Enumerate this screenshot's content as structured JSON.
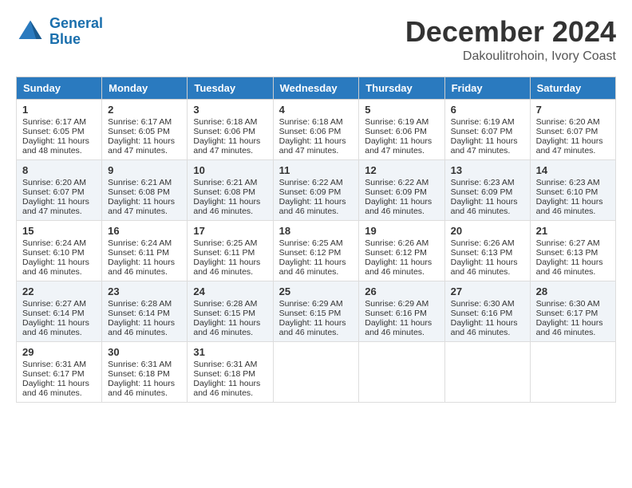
{
  "header": {
    "logo_line1": "General",
    "logo_line2": "Blue",
    "main_title": "December 2024",
    "subtitle": "Dakoulitrohoin, Ivory Coast"
  },
  "calendar": {
    "days_of_week": [
      "Sunday",
      "Monday",
      "Tuesday",
      "Wednesday",
      "Thursday",
      "Friday",
      "Saturday"
    ],
    "weeks": [
      [
        null,
        {
          "day": 2,
          "sunrise": "6:17 AM",
          "sunset": "6:05 PM",
          "daylight": "11 hours and 47 minutes."
        },
        {
          "day": 3,
          "sunrise": "6:18 AM",
          "sunset": "6:06 PM",
          "daylight": "11 hours and 47 minutes."
        },
        {
          "day": 4,
          "sunrise": "6:18 AM",
          "sunset": "6:06 PM",
          "daylight": "11 hours and 47 minutes."
        },
        {
          "day": 5,
          "sunrise": "6:19 AM",
          "sunset": "6:06 PM",
          "daylight": "11 hours and 47 minutes."
        },
        {
          "day": 6,
          "sunrise": "6:19 AM",
          "sunset": "6:07 PM",
          "daylight": "11 hours and 47 minutes."
        },
        {
          "day": 7,
          "sunrise": "6:20 AM",
          "sunset": "6:07 PM",
          "daylight": "11 hours and 47 minutes."
        }
      ],
      [
        {
          "day": 1,
          "sunrise": "6:17 AM",
          "sunset": "6:05 PM",
          "daylight": "11 hours and 48 minutes."
        },
        {
          "day": 8,
          "sunrise": "6:20 AM",
          "sunset": "6:07 PM",
          "daylight": "11 hours and 47 minutes."
        },
        {
          "day": 9,
          "sunrise": "6:21 AM",
          "sunset": "6:08 PM",
          "daylight": "11 hours and 47 minutes."
        },
        {
          "day": 10,
          "sunrise": "6:21 AM",
          "sunset": "6:08 PM",
          "daylight": "11 hours and 46 minutes."
        },
        {
          "day": 11,
          "sunrise": "6:22 AM",
          "sunset": "6:09 PM",
          "daylight": "11 hours and 46 minutes."
        },
        {
          "day": 12,
          "sunrise": "6:22 AM",
          "sunset": "6:09 PM",
          "daylight": "11 hours and 46 minutes."
        },
        {
          "day": 13,
          "sunrise": "6:23 AM",
          "sunset": "6:09 PM",
          "daylight": "11 hours and 46 minutes."
        },
        {
          "day": 14,
          "sunrise": "6:23 AM",
          "sunset": "6:10 PM",
          "daylight": "11 hours and 46 minutes."
        }
      ],
      [
        {
          "day": 15,
          "sunrise": "6:24 AM",
          "sunset": "6:10 PM",
          "daylight": "11 hours and 46 minutes."
        },
        {
          "day": 16,
          "sunrise": "6:24 AM",
          "sunset": "6:11 PM",
          "daylight": "11 hours and 46 minutes."
        },
        {
          "day": 17,
          "sunrise": "6:25 AM",
          "sunset": "6:11 PM",
          "daylight": "11 hours and 46 minutes."
        },
        {
          "day": 18,
          "sunrise": "6:25 AM",
          "sunset": "6:12 PM",
          "daylight": "11 hours and 46 minutes."
        },
        {
          "day": 19,
          "sunrise": "6:26 AM",
          "sunset": "6:12 PM",
          "daylight": "11 hours and 46 minutes."
        },
        {
          "day": 20,
          "sunrise": "6:26 AM",
          "sunset": "6:13 PM",
          "daylight": "11 hours and 46 minutes."
        },
        {
          "day": 21,
          "sunrise": "6:27 AM",
          "sunset": "6:13 PM",
          "daylight": "11 hours and 46 minutes."
        }
      ],
      [
        {
          "day": 22,
          "sunrise": "6:27 AM",
          "sunset": "6:14 PM",
          "daylight": "11 hours and 46 minutes."
        },
        {
          "day": 23,
          "sunrise": "6:28 AM",
          "sunset": "6:14 PM",
          "daylight": "11 hours and 46 minutes."
        },
        {
          "day": 24,
          "sunrise": "6:28 AM",
          "sunset": "6:15 PM",
          "daylight": "11 hours and 46 minutes."
        },
        {
          "day": 25,
          "sunrise": "6:29 AM",
          "sunset": "6:15 PM",
          "daylight": "11 hours and 46 minutes."
        },
        {
          "day": 26,
          "sunrise": "6:29 AM",
          "sunset": "6:16 PM",
          "daylight": "11 hours and 46 minutes."
        },
        {
          "day": 27,
          "sunrise": "6:30 AM",
          "sunset": "6:16 PM",
          "daylight": "11 hours and 46 minutes."
        },
        {
          "day": 28,
          "sunrise": "6:30 AM",
          "sunset": "6:17 PM",
          "daylight": "11 hours and 46 minutes."
        }
      ],
      [
        {
          "day": 29,
          "sunrise": "6:31 AM",
          "sunset": "6:17 PM",
          "daylight": "11 hours and 46 minutes."
        },
        {
          "day": 30,
          "sunrise": "6:31 AM",
          "sunset": "6:18 PM",
          "daylight": "11 hours and 46 minutes."
        },
        {
          "day": 31,
          "sunrise": "6:31 AM",
          "sunset": "6:18 PM",
          "daylight": "11 hours and 46 minutes."
        },
        null,
        null,
        null,
        null
      ]
    ]
  }
}
